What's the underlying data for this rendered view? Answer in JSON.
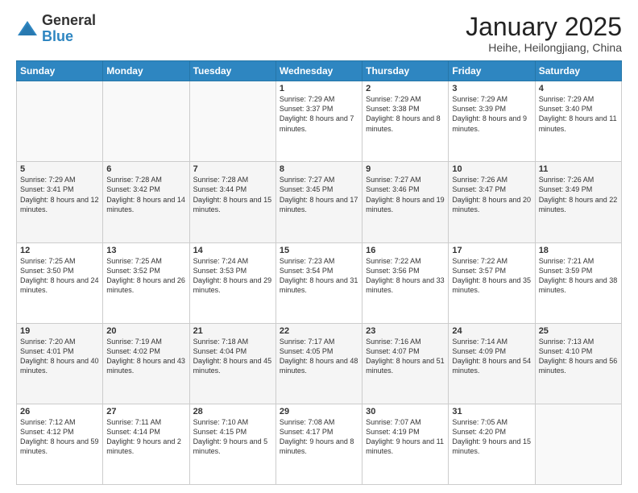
{
  "logo": {
    "general": "General",
    "blue": "Blue"
  },
  "header": {
    "month": "January 2025",
    "location": "Heihe, Heilongjiang, China"
  },
  "days_of_week": [
    "Sunday",
    "Monday",
    "Tuesday",
    "Wednesday",
    "Thursday",
    "Friday",
    "Saturday"
  ],
  "weeks": [
    [
      {
        "day": "",
        "info": ""
      },
      {
        "day": "",
        "info": ""
      },
      {
        "day": "",
        "info": ""
      },
      {
        "day": "1",
        "info": "Sunrise: 7:29 AM\nSunset: 3:37 PM\nDaylight: 8 hours\nand 7 minutes."
      },
      {
        "day": "2",
        "info": "Sunrise: 7:29 AM\nSunset: 3:38 PM\nDaylight: 8 hours\nand 8 minutes."
      },
      {
        "day": "3",
        "info": "Sunrise: 7:29 AM\nSunset: 3:39 PM\nDaylight: 8 hours\nand 9 minutes."
      },
      {
        "day": "4",
        "info": "Sunrise: 7:29 AM\nSunset: 3:40 PM\nDaylight: 8 hours\nand 11 minutes."
      }
    ],
    [
      {
        "day": "5",
        "info": "Sunrise: 7:29 AM\nSunset: 3:41 PM\nDaylight: 8 hours\nand 12 minutes."
      },
      {
        "day": "6",
        "info": "Sunrise: 7:28 AM\nSunset: 3:42 PM\nDaylight: 8 hours\nand 14 minutes."
      },
      {
        "day": "7",
        "info": "Sunrise: 7:28 AM\nSunset: 3:44 PM\nDaylight: 8 hours\nand 15 minutes."
      },
      {
        "day": "8",
        "info": "Sunrise: 7:27 AM\nSunset: 3:45 PM\nDaylight: 8 hours\nand 17 minutes."
      },
      {
        "day": "9",
        "info": "Sunrise: 7:27 AM\nSunset: 3:46 PM\nDaylight: 8 hours\nand 19 minutes."
      },
      {
        "day": "10",
        "info": "Sunrise: 7:26 AM\nSunset: 3:47 PM\nDaylight: 8 hours\nand 20 minutes."
      },
      {
        "day": "11",
        "info": "Sunrise: 7:26 AM\nSunset: 3:49 PM\nDaylight: 8 hours\nand 22 minutes."
      }
    ],
    [
      {
        "day": "12",
        "info": "Sunrise: 7:25 AM\nSunset: 3:50 PM\nDaylight: 8 hours\nand 24 minutes."
      },
      {
        "day": "13",
        "info": "Sunrise: 7:25 AM\nSunset: 3:52 PM\nDaylight: 8 hours\nand 26 minutes."
      },
      {
        "day": "14",
        "info": "Sunrise: 7:24 AM\nSunset: 3:53 PM\nDaylight: 8 hours\nand 29 minutes."
      },
      {
        "day": "15",
        "info": "Sunrise: 7:23 AM\nSunset: 3:54 PM\nDaylight: 8 hours\nand 31 minutes."
      },
      {
        "day": "16",
        "info": "Sunrise: 7:22 AM\nSunset: 3:56 PM\nDaylight: 8 hours\nand 33 minutes."
      },
      {
        "day": "17",
        "info": "Sunrise: 7:22 AM\nSunset: 3:57 PM\nDaylight: 8 hours\nand 35 minutes."
      },
      {
        "day": "18",
        "info": "Sunrise: 7:21 AM\nSunset: 3:59 PM\nDaylight: 8 hours\nand 38 minutes."
      }
    ],
    [
      {
        "day": "19",
        "info": "Sunrise: 7:20 AM\nSunset: 4:01 PM\nDaylight: 8 hours\nand 40 minutes."
      },
      {
        "day": "20",
        "info": "Sunrise: 7:19 AM\nSunset: 4:02 PM\nDaylight: 8 hours\nand 43 minutes."
      },
      {
        "day": "21",
        "info": "Sunrise: 7:18 AM\nSunset: 4:04 PM\nDaylight: 8 hours\nand 45 minutes."
      },
      {
        "day": "22",
        "info": "Sunrise: 7:17 AM\nSunset: 4:05 PM\nDaylight: 8 hours\nand 48 minutes."
      },
      {
        "day": "23",
        "info": "Sunrise: 7:16 AM\nSunset: 4:07 PM\nDaylight: 8 hours\nand 51 minutes."
      },
      {
        "day": "24",
        "info": "Sunrise: 7:14 AM\nSunset: 4:09 PM\nDaylight: 8 hours\nand 54 minutes."
      },
      {
        "day": "25",
        "info": "Sunrise: 7:13 AM\nSunset: 4:10 PM\nDaylight: 8 hours\nand 56 minutes."
      }
    ],
    [
      {
        "day": "26",
        "info": "Sunrise: 7:12 AM\nSunset: 4:12 PM\nDaylight: 8 hours\nand 59 minutes."
      },
      {
        "day": "27",
        "info": "Sunrise: 7:11 AM\nSunset: 4:14 PM\nDaylight: 9 hours\nand 2 minutes."
      },
      {
        "day": "28",
        "info": "Sunrise: 7:10 AM\nSunset: 4:15 PM\nDaylight: 9 hours\nand 5 minutes."
      },
      {
        "day": "29",
        "info": "Sunrise: 7:08 AM\nSunset: 4:17 PM\nDaylight: 9 hours\nand 8 minutes."
      },
      {
        "day": "30",
        "info": "Sunrise: 7:07 AM\nSunset: 4:19 PM\nDaylight: 9 hours\nand 11 minutes."
      },
      {
        "day": "31",
        "info": "Sunrise: 7:05 AM\nSunset: 4:20 PM\nDaylight: 9 hours\nand 15 minutes."
      },
      {
        "day": "",
        "info": ""
      }
    ]
  ]
}
